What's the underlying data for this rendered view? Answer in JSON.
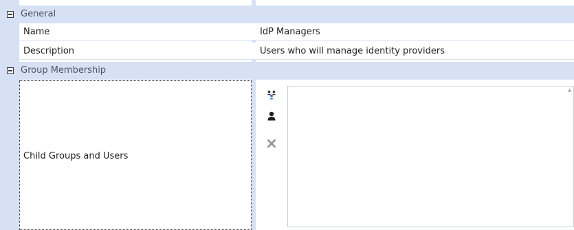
{
  "categories": {
    "general": "General",
    "group_membership": "Group Membership"
  },
  "properties": {
    "name_label": "Name",
    "name_value": "IdP Managers",
    "description_label": "Description",
    "description_value": "Users who will manage identity providers",
    "child_groups_label": "Child Groups and Users"
  },
  "toolbar": {
    "add_group_icon": "add-group-icon",
    "add_user_icon": "add-user-icon",
    "remove_icon": "remove-icon"
  },
  "members": [],
  "colors": {
    "category_background": "#d6e1f5",
    "category_text": "#4a5768",
    "remove_icon": "#9a9a9a"
  }
}
